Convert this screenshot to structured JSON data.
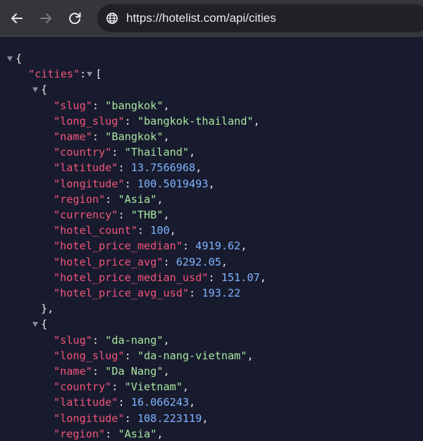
{
  "browser": {
    "url": "https://hotelist.com/api/cities",
    "back_icon": "arrow-left",
    "forward_icon": "arrow-right",
    "reload_icon": "reload",
    "site_icon": "globe",
    "ui_text": "#e8eaed",
    "toolbar_bg": "#35363a",
    "omnibox_bg": "#202124"
  },
  "json_view": {
    "background": "#181b2e",
    "key_color": "#f2547a",
    "string_color": "#a8e6a0",
    "number_color": "#7fb4ff",
    "root_open": "{",
    "cities_key": "\"cities\"",
    "cities_colon": ":",
    "array_open": "[",
    "item_open": "{",
    "item_close": "},",
    "cities": [
      {
        "fields": [
          {
            "key": "\"slug\"",
            "sep": ": ",
            "value": "\"bangkok\"",
            "type": "s",
            "end": ","
          },
          {
            "key": "\"long_slug\"",
            "sep": ": ",
            "value": "\"bangkok-thailand\"",
            "type": "s",
            "end": ","
          },
          {
            "key": "\"name\"",
            "sep": ": ",
            "value": "\"Bangkok\"",
            "type": "s",
            "end": ","
          },
          {
            "key": "\"country\"",
            "sep": ": ",
            "value": "\"Thailand\"",
            "type": "s",
            "end": ","
          },
          {
            "key": "\"latitude\"",
            "sep": ": ",
            "value": "13.7566968",
            "type": "n",
            "end": ","
          },
          {
            "key": "\"longitude\"",
            "sep": ": ",
            "value": "100.5019493",
            "type": "n",
            "end": ","
          },
          {
            "key": "\"region\"",
            "sep": ": ",
            "value": "\"Asia\"",
            "type": "s",
            "end": ","
          },
          {
            "key": "\"currency\"",
            "sep": ": ",
            "value": "\"THB\"",
            "type": "s",
            "end": ","
          },
          {
            "key": "\"hotel_count\"",
            "sep": ": ",
            "value": "100",
            "type": "n",
            "end": ","
          },
          {
            "key": "\"hotel_price_median\"",
            "sep": ": ",
            "value": "4919.62",
            "type": "n",
            "end": ","
          },
          {
            "key": "\"hotel_price_avg\"",
            "sep": ": ",
            "value": "6292.05",
            "type": "n",
            "end": ","
          },
          {
            "key": "\"hotel_price_median_usd\"",
            "sep": ": ",
            "value": "151.07",
            "type": "n",
            "end": ","
          },
          {
            "key": "\"hotel_price_avg_usd\"",
            "sep": ": ",
            "value": "193.22",
            "type": "n",
            "end": ""
          }
        ]
      },
      {
        "fields": [
          {
            "key": "\"slug\"",
            "sep": ": ",
            "value": "\"da-nang\"",
            "type": "s",
            "end": ","
          },
          {
            "key": "\"long_slug\"",
            "sep": ": ",
            "value": "\"da-nang-vietnam\"",
            "type": "s",
            "end": ","
          },
          {
            "key": "\"name\"",
            "sep": ": ",
            "value": "\"Da Nang\"",
            "type": "s",
            "end": ","
          },
          {
            "key": "\"country\"",
            "sep": ": ",
            "value": "\"Vietnam\"",
            "type": "s",
            "end": ","
          },
          {
            "key": "\"latitude\"",
            "sep": ": ",
            "value": "16.066243",
            "type": "n",
            "end": ","
          },
          {
            "key": "\"longitude\"",
            "sep": ": ",
            "value": "108.223119",
            "type": "n",
            "end": ","
          },
          {
            "key": "\"region\"",
            "sep": ": ",
            "value": "\"Asia\"",
            "type": "s",
            "end": ","
          }
        ]
      }
    ]
  }
}
